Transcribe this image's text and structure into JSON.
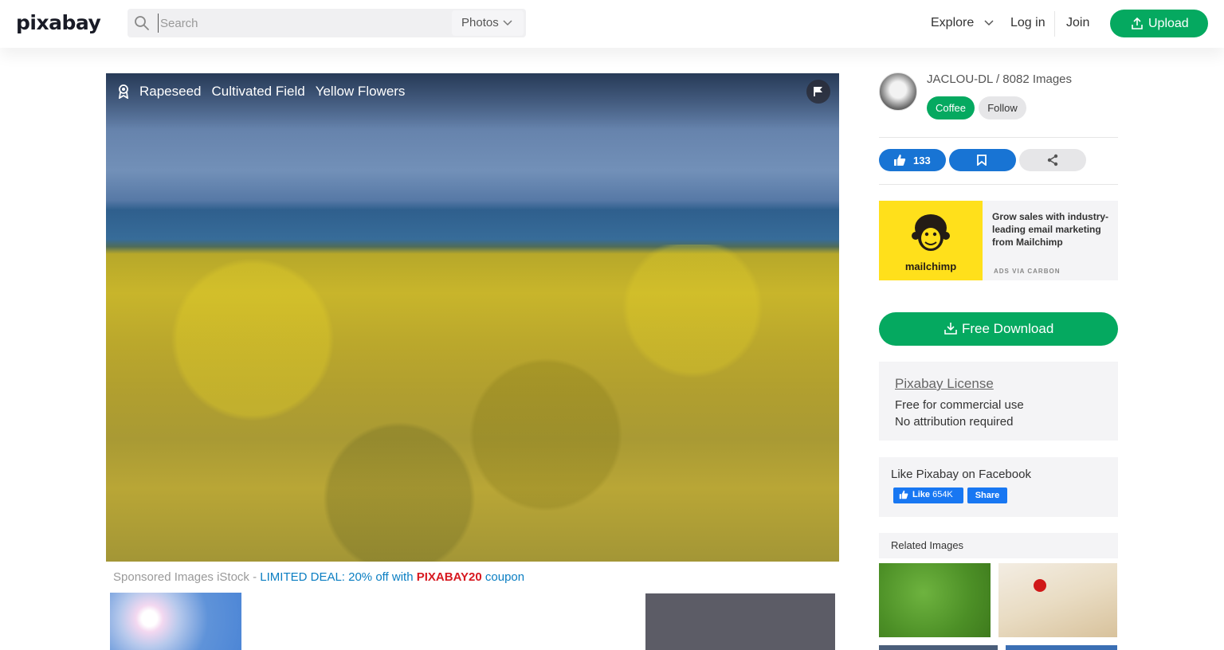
{
  "header": {
    "logo": "pixabay",
    "search": {
      "placeholder": "Search",
      "type": "Photos"
    },
    "nav": {
      "explore": "Explore",
      "login": "Log in",
      "join": "Join",
      "upload": "Upload"
    }
  },
  "photo": {
    "tags": [
      "Rapeseed",
      "Cultivated Field",
      "Yellow Flowers"
    ]
  },
  "sponsored": {
    "prefix": "Sponsored Images iStock - ",
    "deal": "LIMITED DEAL: 20% off with ",
    "code": "PIXABAY20",
    "suffix": " coupon"
  },
  "author": {
    "name": "JACLOU-DL / 8082 Images",
    "coffee": "Coffee",
    "follow": "Follow"
  },
  "actions": {
    "likes": "133"
  },
  "ad": {
    "brand": "mailchimp",
    "text": "Grow sales with industry-leading email marketing from Mailchimp",
    "via": "ADS VIA CARBON"
  },
  "download": {
    "label": "Free Download"
  },
  "license": {
    "link": "Pixabay License",
    "line1": "Free for commercial use",
    "line2": "No attribution required"
  },
  "facebook": {
    "title": "Like Pixabay on Facebook",
    "like": "Like",
    "count": "654K",
    "share": "Share"
  },
  "related": {
    "title": "Related Images"
  },
  "colors": {
    "brand_green": "#05a960",
    "action_blue": "#1874d4",
    "coupon_red": "#d71920",
    "deal_blue": "#0a7ec2"
  }
}
